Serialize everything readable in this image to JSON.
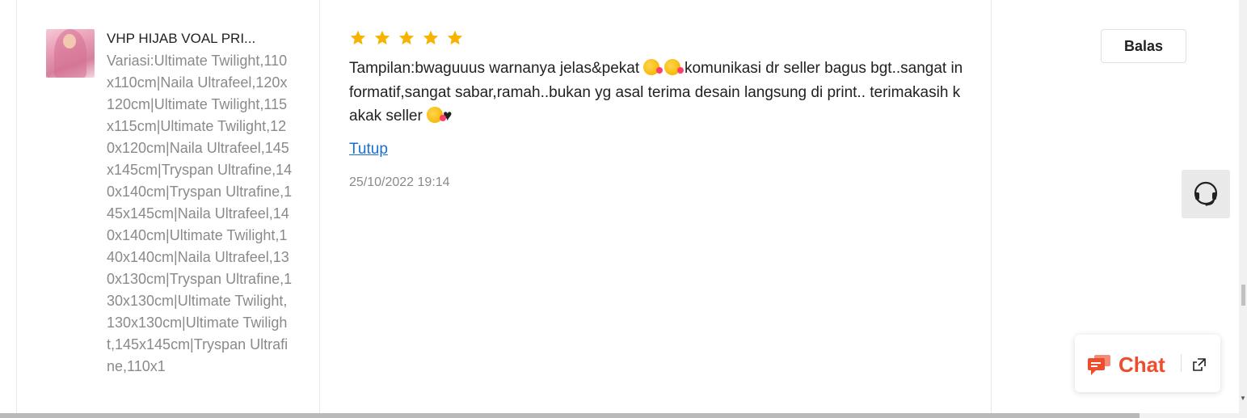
{
  "product": {
    "name": "VHP HIJAB VOAL PRI...",
    "variation": "Variasi:Ultimate Twilight,110x110cm|Naila Ultrafeel,120x120cm|Ultimate Twilight,115x115cm|Ultimate Twilight,120x120cm|Naila Ultrafeel,145x145cm|Tryspan Ultrafine,140x140cm|Tryspan Ultrafine,145x145cm|Naila Ultrafeel,140x140cm|Ultimate Twilight,140x140cm|Naila Ultrafeel,130x130cm|Tryspan Ultrafine,130x130cm|Ultimate Twilight,130x130cm|Ultimate Twilight,145x145cm|Tryspan Ultrafine,110x1"
  },
  "review": {
    "rating": 5,
    "text_part1": "Tampilan:bwaguuus warnanya jelas&pekat ",
    "text_part2": " komunikasi dr seller bagus bgt..sangat informatif,sangat sabar,ramah..bukan yg asal terima desain langsung di print.. terimakasih kakak seller ",
    "text_end": "♥",
    "collapse_label": "Tutup",
    "timestamp": "25/10/2022 19:14"
  },
  "actions": {
    "reply_label": "Balas"
  },
  "chat": {
    "label": "Chat"
  },
  "colors": {
    "star": "#f6b300",
    "link": "#1a6fd1",
    "chat_accent": "#ee4d2d",
    "muted": "#8a8a8a"
  },
  "icons": [
    "star-icon",
    "headset-icon",
    "chat-bubble-icon",
    "popout-icon",
    "hijab-product-image"
  ]
}
